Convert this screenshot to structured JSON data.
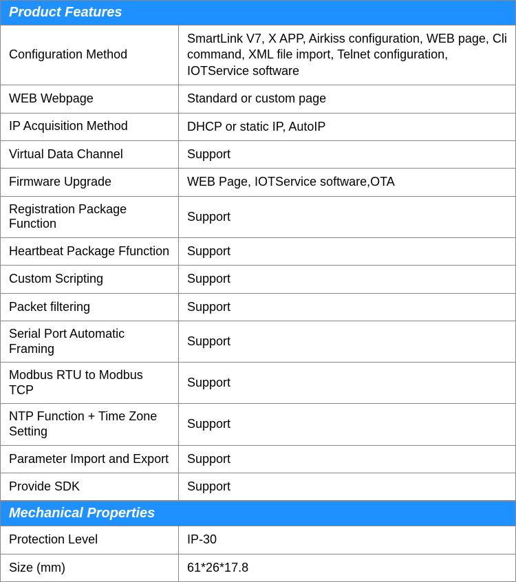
{
  "sections": [
    {
      "title": "Product Features",
      "rows": [
        {
          "label": "Configuration Method",
          "value": "SmartLink V7, X APP, Airkiss configuration, WEB page, Cli command, XML file import, Telnet configuration, IOTService software"
        },
        {
          "label": "WEB Webpage",
          "value": "Standard or custom page"
        },
        {
          "label": "IP Acquisition Method",
          "value": "DHCP or static IP, AutoIP"
        },
        {
          "label": "Virtual Data Channel",
          "value": "Support"
        },
        {
          "label": "Firmware Upgrade",
          "value": "WEB Page, IOTService software,OTA"
        },
        {
          "label": "Registration Package Function",
          "value": "Support"
        },
        {
          "label": "Heartbeat Package Ffunction",
          "value": "Support"
        },
        {
          "label": "Custom Scripting",
          "value": "Support"
        },
        {
          "label": "Packet filtering",
          "value": "Support"
        },
        {
          "label": "Serial Port Automatic Framing",
          "value": "Support"
        },
        {
          "label": "Modbus RTU to Modbus TCP",
          "value": "Support"
        },
        {
          "label": "NTP Function + Time Zone Setting",
          "value": "Support"
        },
        {
          "label": "Parameter Import and Export",
          "value": "Support"
        },
        {
          "label": "Provide SDK",
          "value": "Support"
        }
      ]
    },
    {
      "title": "Mechanical Properties",
      "rows": [
        {
          "label": "Protection Level",
          "value": "IP-30"
        },
        {
          "label": "Size (mm)",
          "value": "61*26*17.8"
        }
      ]
    }
  ]
}
